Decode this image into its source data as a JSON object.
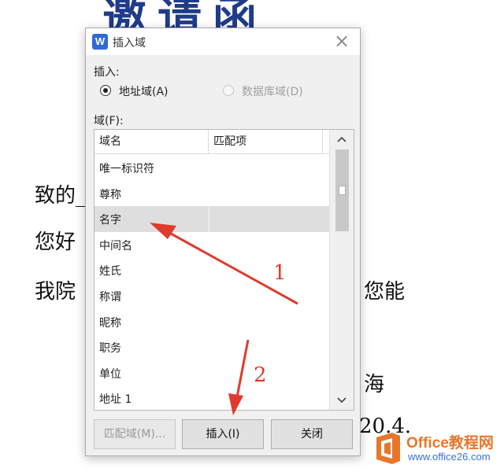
{
  "document": {
    "title_fragment": "邀请函",
    "lines": [
      "致的_",
      "您好",
      "我院",
      "您能",
      "海",
      "20.4."
    ]
  },
  "dialog": {
    "app_icon": "W",
    "title": "插入域",
    "insert_label": "插入:",
    "radio_address": "地址域(A)",
    "radio_database": "数据库域(D)",
    "field_label": "域(F):",
    "columns": [
      "域名",
      "匹配项"
    ],
    "items": [
      "唯一标识符",
      "尊称",
      "名字",
      "中间名",
      "姓氏",
      "称谓",
      "昵称",
      "职务",
      "单位",
      "地址 1"
    ],
    "selected_item": "名字",
    "buttons": {
      "match": "匹配域(M)...",
      "insert": "插入(I)",
      "close": "关闭"
    }
  },
  "annotations": {
    "step1": "1",
    "step2": "2",
    "arrow_color": "#e03a2e"
  },
  "watermark": {
    "brand": "Office教程网",
    "url": "www.office26.com"
  },
  "icons": {
    "close": "close-icon",
    "scroll_up": "chevron-up-icon",
    "scroll_down": "chevron-down-icon",
    "app": "wps-writer-icon",
    "logo": "office-logo-icon"
  }
}
